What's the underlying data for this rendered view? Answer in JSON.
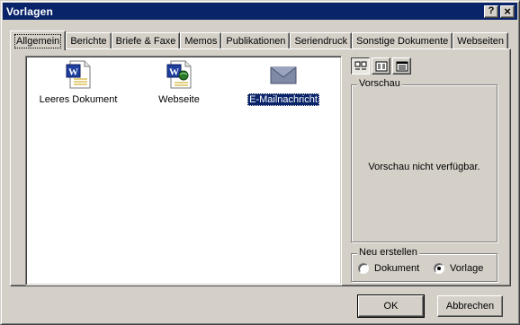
{
  "window": {
    "title": "Vorlagen",
    "help_button": "?",
    "close_button": "×"
  },
  "tabs": [
    {
      "label": "Allgemein",
      "active": true
    },
    {
      "label": "Berichte",
      "active": false
    },
    {
      "label": "Briefe & Faxe",
      "active": false
    },
    {
      "label": "Memos",
      "active": false
    },
    {
      "label": "Publikationen",
      "active": false
    },
    {
      "label": "Seriendruck",
      "active": false
    },
    {
      "label": "Sonstige Dokumente",
      "active": false
    },
    {
      "label": "Webseiten",
      "active": false
    }
  ],
  "templates": [
    {
      "label": "Leeres Dokument",
      "icon": "word-document-icon",
      "selected": false
    },
    {
      "label": "Webseite",
      "icon": "word-webpage-icon",
      "selected": false
    },
    {
      "label": "E-Mailnachricht",
      "icon": "envelope-icon",
      "selected": true
    }
  ],
  "view_buttons": [
    {
      "name": "large-icons",
      "pressed": true
    },
    {
      "name": "list",
      "pressed": false
    },
    {
      "name": "details",
      "pressed": false
    }
  ],
  "preview": {
    "legend": "Vorschau",
    "text": "Vorschau nicht verfügbar."
  },
  "create_new": {
    "legend": "Neu erstellen",
    "options": [
      {
        "label": "Dokument",
        "checked": false
      },
      {
        "label": "Vorlage",
        "checked": true
      }
    ]
  },
  "buttons": {
    "ok": "OK",
    "cancel": "Abbrechen"
  },
  "colors": {
    "titlebar": "#0a246a",
    "face": "#d4d0c8",
    "selection": "#0a246a"
  }
}
